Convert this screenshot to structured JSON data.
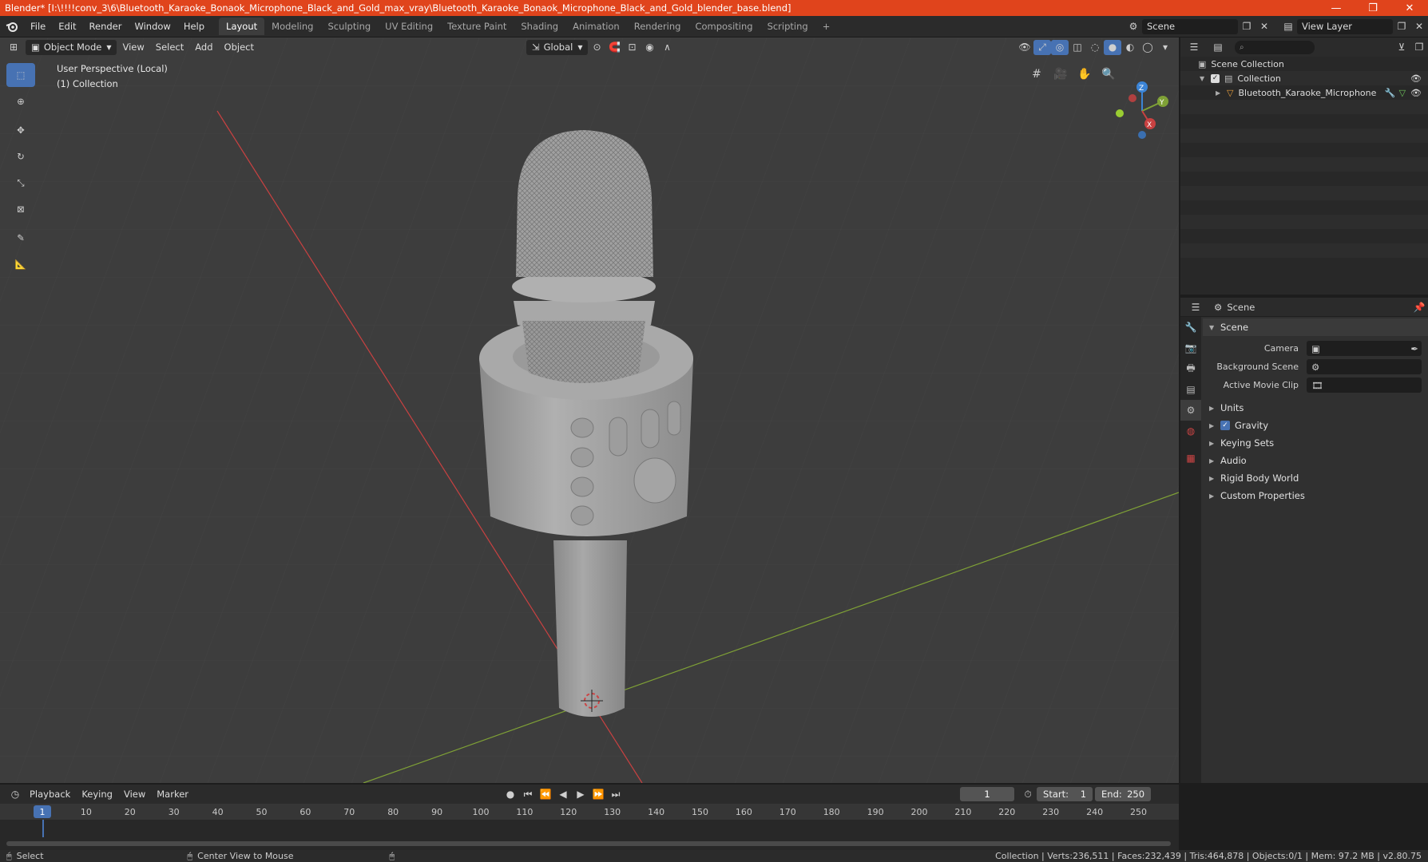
{
  "window": {
    "title": "Blender* [I:\\!!!!conv_3\\6\\Bluetooth_Karaoke_Bonaok_Microphone_Black_and_Gold_max_vray\\Bluetooth_Karaoke_Bonaok_Microphone_Black_and_Gold_blender_base.blend]",
    "minimize": "—",
    "restore": "❐",
    "close": "✕"
  },
  "menu": {
    "items": [
      "File",
      "Edit",
      "Render",
      "Window",
      "Help"
    ]
  },
  "workspaces": {
    "tabs": [
      "Layout",
      "Modeling",
      "Sculpting",
      "UV Editing",
      "Texture Paint",
      "Shading",
      "Animation",
      "Rendering",
      "Compositing",
      "Scripting"
    ],
    "active": "Layout",
    "add": "+"
  },
  "scene_selector": {
    "value": "Scene"
  },
  "view_layer_selector": {
    "value": "View Layer"
  },
  "viewport": {
    "mode": "Object Mode",
    "menus": [
      "View",
      "Select",
      "Add",
      "Object"
    ],
    "transform_orientation": "Global",
    "info_line1": "User Perspective (Local)",
    "info_line2": "(1) Collection",
    "gizmo": {
      "x": "X",
      "y": "Y",
      "z": "Z"
    }
  },
  "outliner": {
    "search_placeholder": "",
    "rows": [
      {
        "label": "Scene Collection"
      },
      {
        "label": "Collection"
      },
      {
        "label": "Bluetooth_Karaoke_Microphone"
      }
    ]
  },
  "properties": {
    "context": "Scene",
    "panel_title": "Scene",
    "fields": [
      {
        "label": "Camera",
        "value": ""
      },
      {
        "label": "Background Scene",
        "value": ""
      },
      {
        "label": "Active Movie Clip",
        "value": ""
      }
    ],
    "sections": [
      "Units",
      "Gravity",
      "Keying Sets",
      "Audio",
      "Rigid Body World",
      "Custom Properties"
    ],
    "gravity_checked": true
  },
  "timeline": {
    "menus": [
      "Playback",
      "Keying",
      "View",
      "Marker"
    ],
    "current_frame": "1",
    "start_label": "Start:",
    "start": "1",
    "end_label": "End:",
    "end": "250",
    "ruler": [
      "1",
      "10",
      "20",
      "30",
      "40",
      "50",
      "60",
      "70",
      "80",
      "90",
      "100",
      "110",
      "120",
      "130",
      "140",
      "150",
      "160",
      "170",
      "180",
      "190",
      "200",
      "210",
      "220",
      "230",
      "240",
      "250"
    ]
  },
  "statusbar": {
    "select": "Select",
    "center_view": "Center View to Mouse",
    "stats": "Collection | Verts:236,511 | Faces:232,439 | Tris:464,878 | Objects:0/1 | Mem: 97.2 MB | v2.80.75"
  },
  "colors": {
    "titlebar": "#e0441c",
    "accent": "#4772b3",
    "x_axis": "#c94141",
    "y_axis": "#7fa136",
    "z_axis": "#3b84d6"
  }
}
